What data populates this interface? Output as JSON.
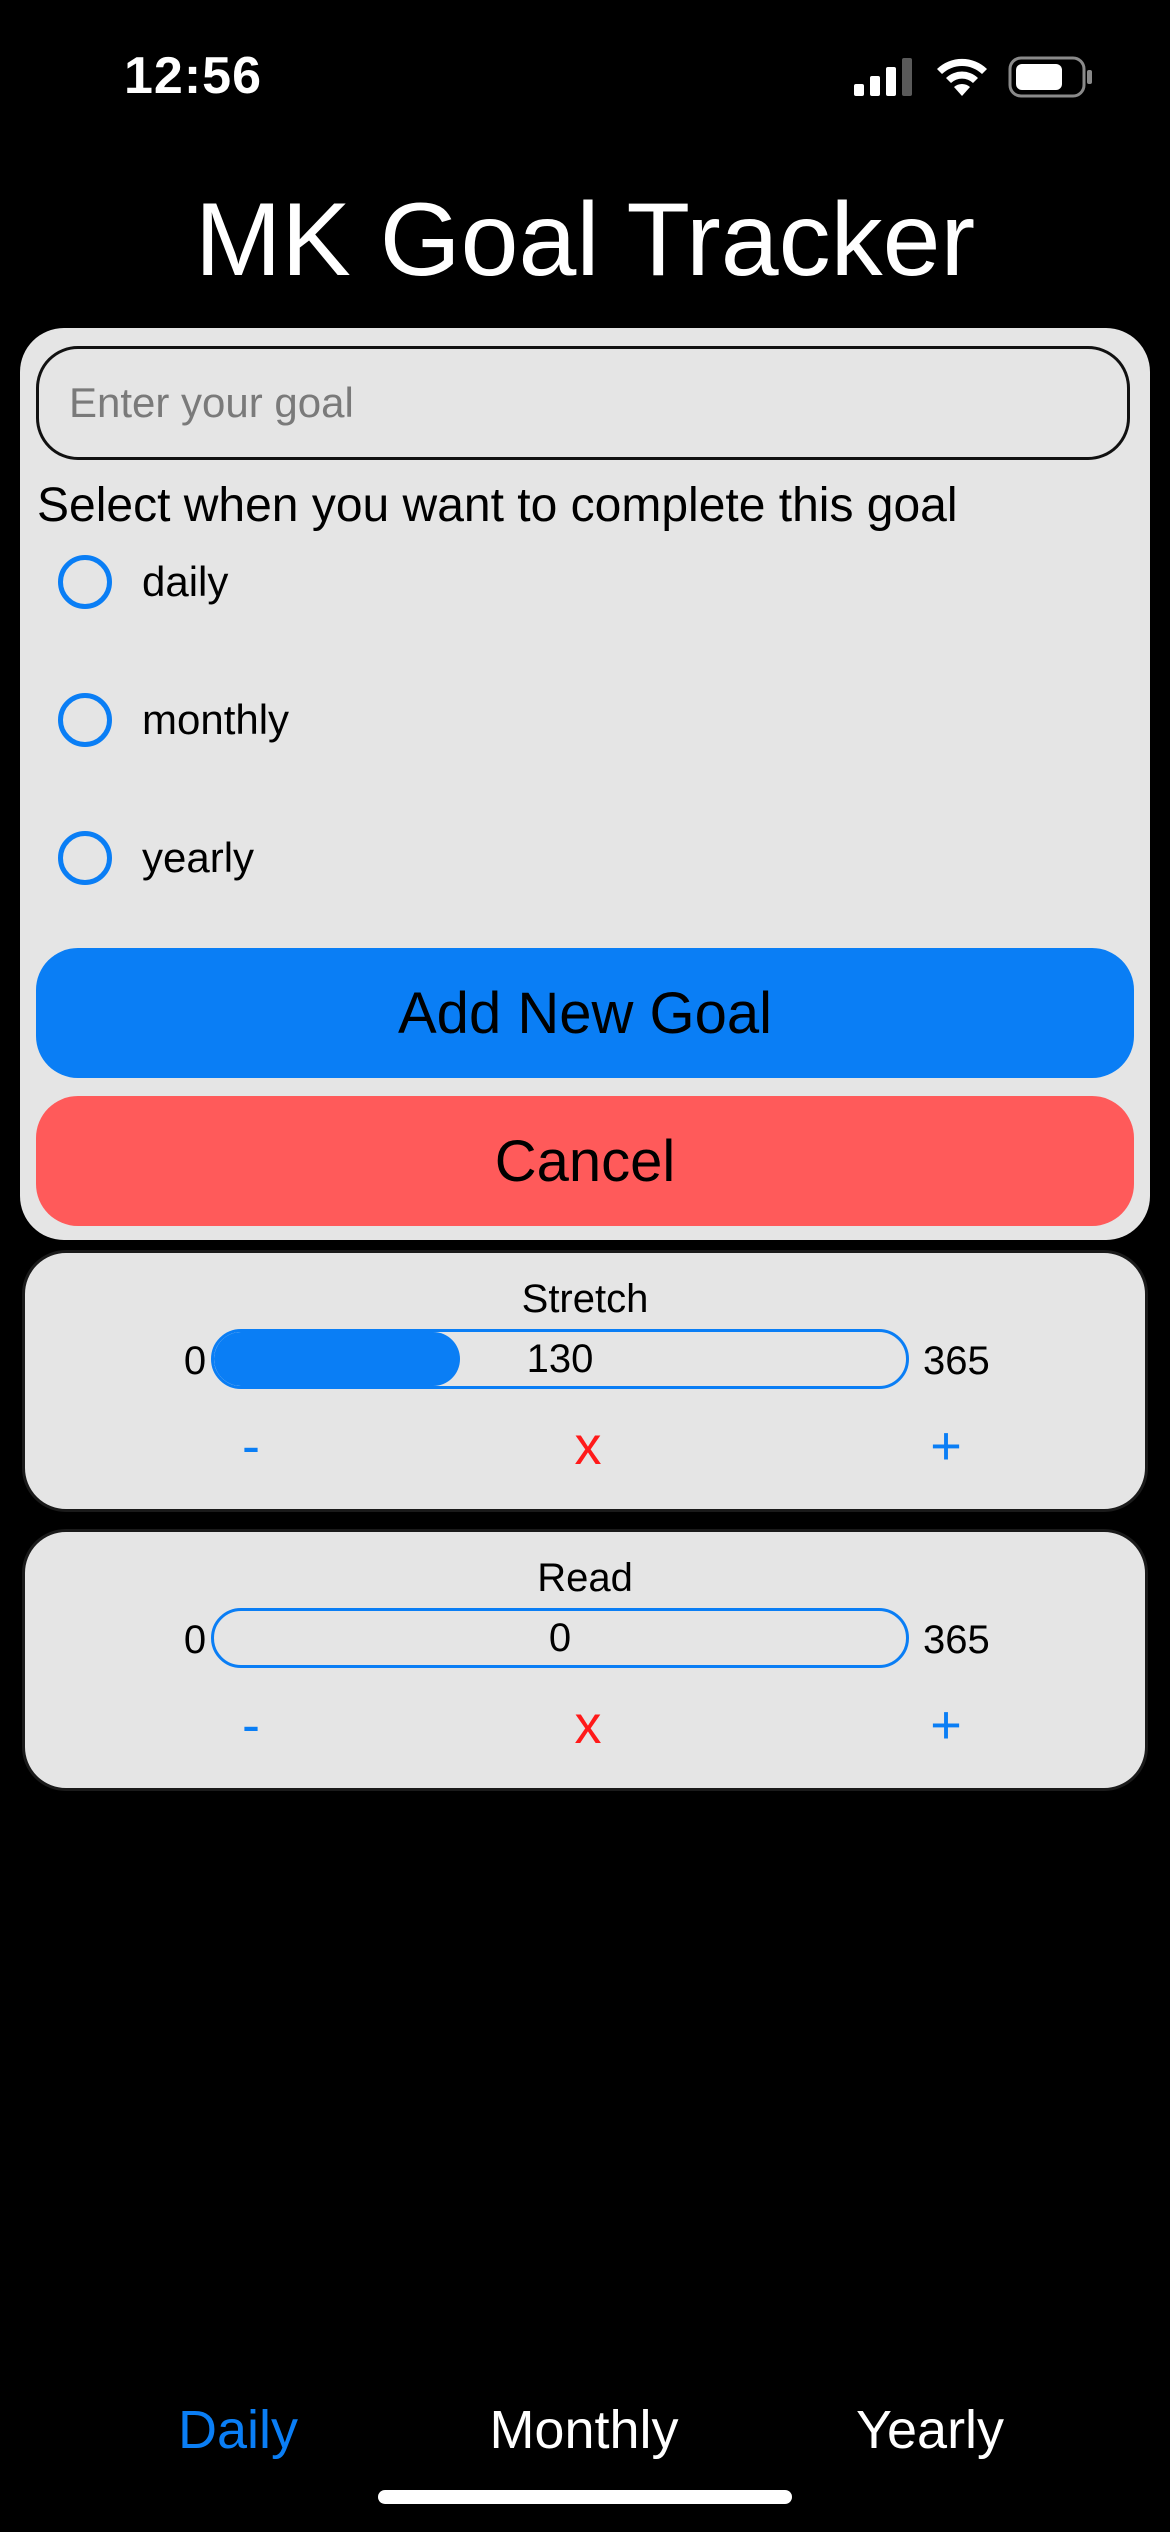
{
  "status_bar": {
    "time": "12:56",
    "icons": [
      "signal-icon",
      "wifi-icon",
      "battery-icon"
    ]
  },
  "app": {
    "title": "MK Goal Tracker"
  },
  "form": {
    "goal_input": {
      "value": "",
      "placeholder": "Enter your goal"
    },
    "frequency_prompt": "Select when you want to complete this goal",
    "frequency_options": [
      {
        "label": "daily",
        "selected": false
      },
      {
        "label": "monthly",
        "selected": false
      },
      {
        "label": "yearly",
        "selected": false
      }
    ],
    "add_button_label": "Add New Goal",
    "cancel_button_label": "Cancel"
  },
  "goals": [
    {
      "name": "Stretch",
      "min": "0",
      "max": "365",
      "value": "130",
      "progress": 130,
      "progress_max": 365,
      "decrement_label": "-",
      "delete_label": "x",
      "increment_label": "+"
    },
    {
      "name": "Read",
      "min": "0",
      "max": "365",
      "value": "0",
      "progress": 0,
      "progress_max": 365,
      "decrement_label": "-",
      "delete_label": "x",
      "increment_label": "+"
    }
  ],
  "tabs": [
    {
      "label": "Daily",
      "active": true
    },
    {
      "label": "Monthly",
      "active": false
    },
    {
      "label": "Yearly",
      "active": false
    }
  ],
  "colors": {
    "accent": "#0a7ef5",
    "danger_button": "#ff5a5a",
    "delete_icon": "#ff1a1a",
    "card_background": "#e5e5e5",
    "page_background": "#000000"
  }
}
